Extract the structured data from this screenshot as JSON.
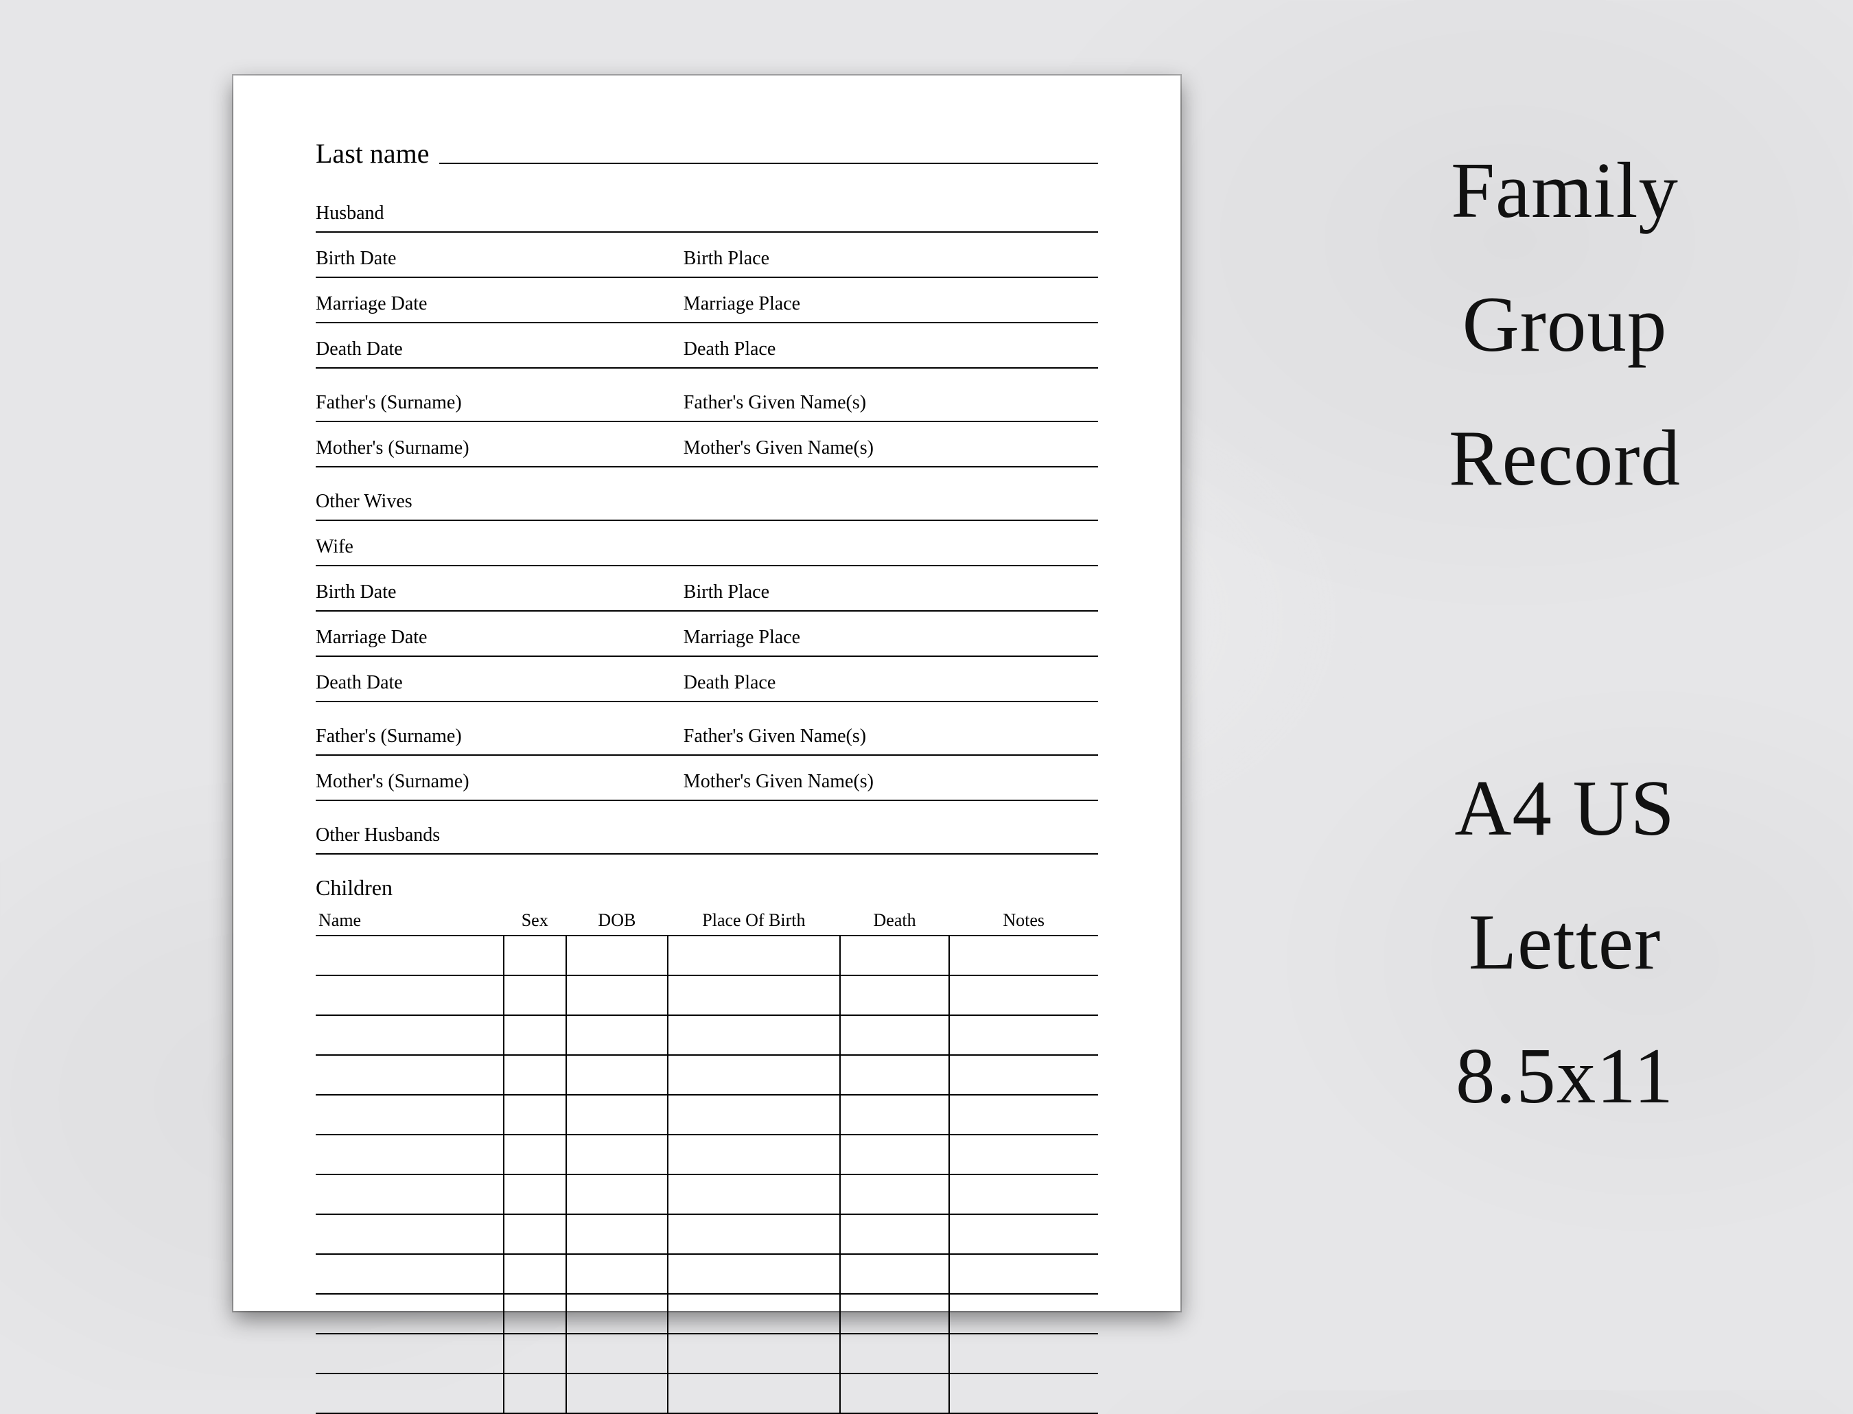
{
  "form": {
    "last_name_label": "Last name",
    "husband": {
      "heading": "Husband",
      "birth_date": "Birth Date",
      "birth_place": "Birth Place",
      "marriage_date": "Marriage Date",
      "marriage_place": "Marriage Place",
      "death_date": "Death Date",
      "death_place": "Death Place",
      "father_surname": "Father's (Surname)",
      "father_given": "Father's Given Name(s)",
      "mother_surname": "Mother's (Surname)",
      "mother_given": "Mother's Given Name(s)",
      "other_spouses": "Other Wives"
    },
    "wife": {
      "heading": "Wife",
      "birth_date": "Birth Date",
      "birth_place": "Birth Place",
      "marriage_date": "Marriage Date",
      "marriage_place": "Marriage Place",
      "death_date": "Death Date",
      "death_place": "Death Place",
      "father_surname": "Father's (Surname)",
      "father_given": "Father's Given Name(s)",
      "mother_surname": "Mother's (Surname)",
      "mother_given": "Mother's Given Name(s)",
      "other_spouses": "Other Husbands"
    },
    "children": {
      "heading": "Children",
      "columns": {
        "name": "Name",
        "sex": "Sex",
        "dob": "DOB",
        "pob": "Place Of Birth",
        "death": "Death",
        "notes": "Notes"
      },
      "row_count": 12
    }
  },
  "promo": {
    "title": {
      "l1": "Family",
      "l2": "Group",
      "l3": "Record"
    },
    "size": {
      "l1": "A4 US",
      "l2": "Letter",
      "l3": "8.5x11"
    }
  }
}
